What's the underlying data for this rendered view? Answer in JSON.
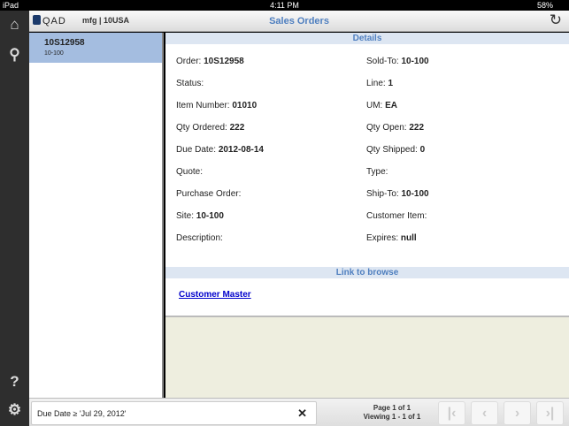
{
  "status": {
    "device": "iPad",
    "time": "4:11 PM",
    "battery": "58%"
  },
  "header": {
    "logo": "QAD",
    "org": "mfg | 10USA",
    "title": "Sales Orders"
  },
  "list": [
    {
      "title": "10S12958",
      "sub": "10-100"
    }
  ],
  "details": {
    "section": "Details",
    "fields": [
      {
        "label": "Order:",
        "value": "10S12958"
      },
      {
        "label": "Sold-To:",
        "value": "10-100"
      },
      {
        "label": "Status:",
        "value": ""
      },
      {
        "label": "Line:",
        "value": "1"
      },
      {
        "label": "Item Number:",
        "value": "01010"
      },
      {
        "label": "UM:",
        "value": "EA"
      },
      {
        "label": "Qty Ordered:",
        "value": "222"
      },
      {
        "label": "Qty Open:",
        "value": "222"
      },
      {
        "label": "Due Date:",
        "value": "2012-08-14"
      },
      {
        "label": "Qty Shipped:",
        "value": "0"
      },
      {
        "label": "Quote:",
        "value": ""
      },
      {
        "label": "Type:",
        "value": ""
      },
      {
        "label": "Purchase Order:",
        "value": ""
      },
      {
        "label": "Ship-To:",
        "value": "10-100"
      },
      {
        "label": "Site:",
        "value": "10-100"
      },
      {
        "label": "Customer Item:",
        "value": ""
      },
      {
        "label": "Description:",
        "value": ""
      },
      {
        "label": "Expires:",
        "value": "null"
      }
    ]
  },
  "browse": {
    "section": "Link to browse",
    "link": "Customer Master"
  },
  "footer": {
    "filter": "Due Date ≥ 'Jul 29, 2012'",
    "page": "Page 1 of 1",
    "viewing": "Viewing 1 - 1 of 1"
  }
}
